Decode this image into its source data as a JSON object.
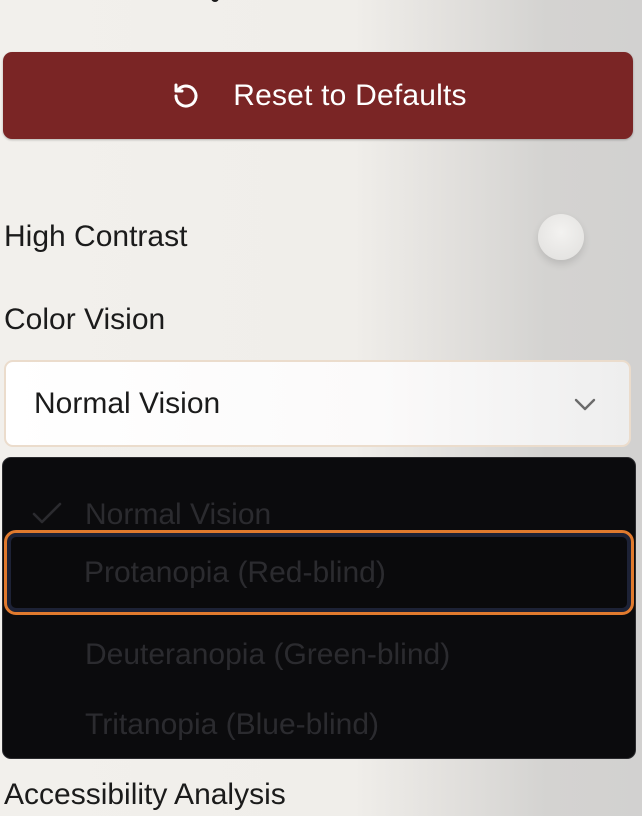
{
  "reset_button": {
    "label": "Reset to Defaults",
    "icon": "reset-icon",
    "color": "#7a2525"
  },
  "high_contrast": {
    "label": "High Contrast"
  },
  "color_vision": {
    "label": "Color Vision",
    "selected_value": "Normal Vision",
    "options": [
      {
        "label": "Normal Vision",
        "checked": true
      },
      {
        "label": "Protanopia (Red-blind)",
        "checked": false,
        "focused": true
      },
      {
        "label": "Deuteranopia (Green-blind)",
        "checked": false
      },
      {
        "label": "Tritanopia (Blue-blind)",
        "checked": false
      }
    ]
  },
  "accessibility_analysis": {
    "label": "Accessibility Analysis"
  },
  "colors": {
    "focus_ring": "#e07a2e",
    "menu_background": "#0b0b0d"
  }
}
